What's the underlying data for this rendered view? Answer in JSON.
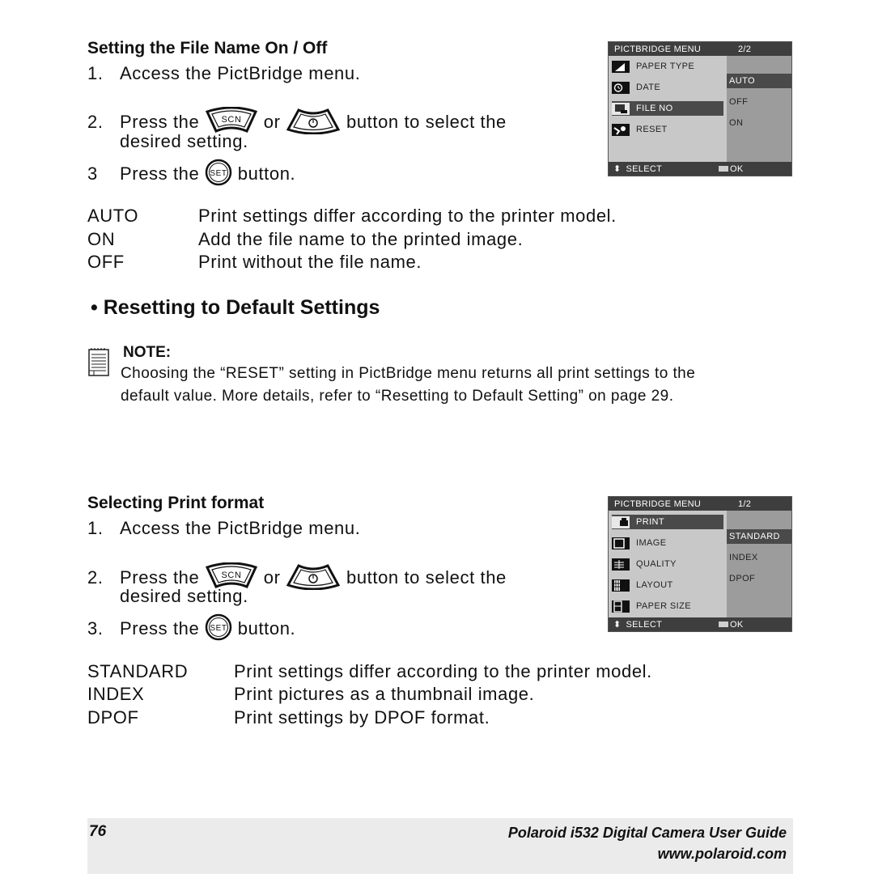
{
  "section1": {
    "heading": "Setting the File Name On / Off",
    "steps": [
      {
        "num": "1.",
        "text": "Access the PictBridge menu."
      },
      {
        "num": "2.",
        "pre": "Press the",
        "mid": "or",
        "post": "button to select the",
        "cont": "desired setting."
      },
      {
        "num": "3",
        "pre": "Press the",
        "post": "button."
      }
    ],
    "definitions": [
      {
        "term": "AUTO",
        "desc": "Print settings differ according to the printer model."
      },
      {
        "term": "ON",
        "desc": "Add the file name to the printed image."
      },
      {
        "term": "OFF",
        "desc": "Print without the file name."
      }
    ],
    "lcd": {
      "title": "PICTBRIDGE MENU",
      "page": "2/2",
      "items": [
        {
          "label": "PAPER TYPE",
          "icon": "paper-type-icon",
          "selected": false
        },
        {
          "label": "DATE",
          "icon": "clock-icon",
          "selected": false
        },
        {
          "label": "FILE NO",
          "icon": "file-number-icon",
          "selected": true
        },
        {
          "label": "RESET",
          "icon": "wrench-reset-icon",
          "selected": false
        }
      ],
      "options": [
        {
          "label": "AUTO",
          "selected": true
        },
        {
          "label": "OFF",
          "selected": false
        },
        {
          "label": "ON",
          "selected": false
        }
      ],
      "footer_select": "SELECT",
      "footer_ok": "OK"
    }
  },
  "section_reset": {
    "heading": "• Resetting to Default Settings",
    "note_label": "NOTE:",
    "note_line1": "Choosing the “RESET” setting in PictBridge menu returns all print settings to the",
    "note_line2": "default value. More details, refer to “Resetting to Default Setting” on page 29."
  },
  "section2": {
    "heading": "Selecting Print format",
    "steps": [
      {
        "num": "1.",
        "text": "Access the PictBridge menu."
      },
      {
        "num": "2.",
        "pre": "Press the",
        "mid": "or",
        "post": "button to select the",
        "cont": "desired setting."
      },
      {
        "num": "3.",
        "pre": "Press the",
        "post": "button."
      }
    ],
    "definitions": [
      {
        "term": "STANDARD",
        "desc": "Print settings differ according to the printer model."
      },
      {
        "term": "INDEX",
        "desc": "Print pictures as a thumbnail image."
      },
      {
        "term": "DPOF",
        "desc": "Print settings by DPOF format."
      }
    ],
    "lcd": {
      "title": "PICTBRIDGE MENU",
      "page": "1/2",
      "items": [
        {
          "label": "PRINT",
          "icon": "printer-icon",
          "selected": true
        },
        {
          "label": "IMAGE",
          "icon": "image-icon",
          "selected": false
        },
        {
          "label": "QUALITY",
          "icon": "quality-icon",
          "selected": false
        },
        {
          "label": "LAYOUT",
          "icon": "layout-icon",
          "selected": false
        },
        {
          "label": "PAPER SIZE",
          "icon": "paper-size-icon",
          "selected": false
        }
      ],
      "options": [
        {
          "label": "STANDARD",
          "selected": true
        },
        {
          "label": "INDEX",
          "selected": false
        },
        {
          "label": "DPOF",
          "selected": false
        }
      ],
      "footer_select": "SELECT",
      "footer_ok": "OK"
    }
  },
  "buttons": {
    "scn": "SCN",
    "set": "SET"
  },
  "footer": {
    "page_number": "76",
    "guide_title": "Polaroid i532 Digital Camera User Guide",
    "url": "www.polaroid.com"
  }
}
